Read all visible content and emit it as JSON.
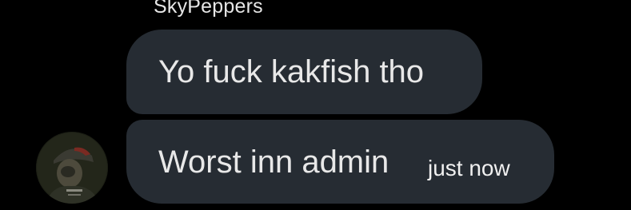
{
  "chat": {
    "sender_name": "SkyPeppers",
    "messages": [
      {
        "text": "Yo fuck kakfish tho"
      },
      {
        "text": "Worst inn admin",
        "timestamp": "just now"
      }
    ]
  },
  "colors": {
    "background": "#000000",
    "bubble": "#262c33",
    "text": "#e8e8e8"
  },
  "icons": {
    "avatar": "user-avatar-photo"
  }
}
